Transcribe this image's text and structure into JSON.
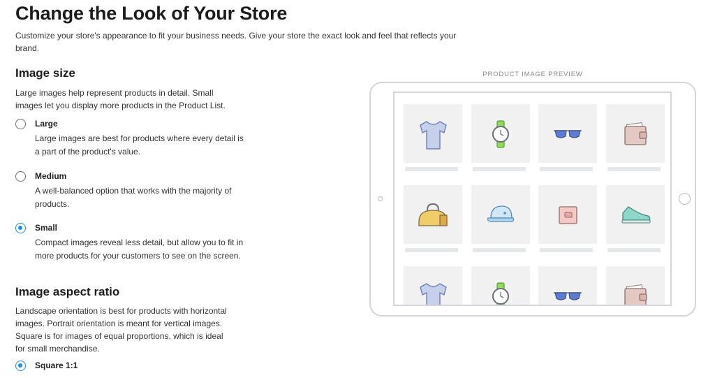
{
  "header": {
    "title": "Change the Look of Your Store",
    "description": "Customize your store's appearance to fit your business needs. Give your store the exact look and feel that reflects your brand."
  },
  "image_size": {
    "title": "Image size",
    "description": "Large images help represent products in detail. Small images let you display more products in the Product List.",
    "options": [
      {
        "label": "Large",
        "description": "Large images are best for products where every detail is a part of the product's value.",
        "selected": false
      },
      {
        "label": "Medium",
        "description": "A well-balanced option that works with the majority of products.",
        "selected": false
      },
      {
        "label": "Small",
        "description": "Compact images reveal less detail, but allow you to fit in more products for your customers to see on the screen.",
        "selected": true
      }
    ]
  },
  "aspect_ratio": {
    "title": "Image aspect ratio",
    "description": "Landscape orientation is best for products with horizontal images. Portrait orientation is meant for vertical images. Square is for images of equal proportions, which is ideal for small merchandise.",
    "options": [
      {
        "label": "Square 1:1",
        "selected": true
      }
    ]
  },
  "preview": {
    "label": "PRODUCT IMAGE PREVIEW",
    "grid_rows": [
      [
        "t-shirt-icon",
        "watch-icon",
        "sunglasses-icon",
        "wallet-icon"
      ],
      [
        "bag-icon",
        "cap-icon",
        "purse-icon",
        "sneaker-icon"
      ],
      [
        "t-shirt-icon",
        "watch-icon",
        "sunglasses-icon",
        "wallet-icon"
      ]
    ]
  },
  "colors": {
    "accent": "#1a8fe3",
    "tile_bg": "#f1f1f2",
    "device_border": "#d3d6da"
  }
}
